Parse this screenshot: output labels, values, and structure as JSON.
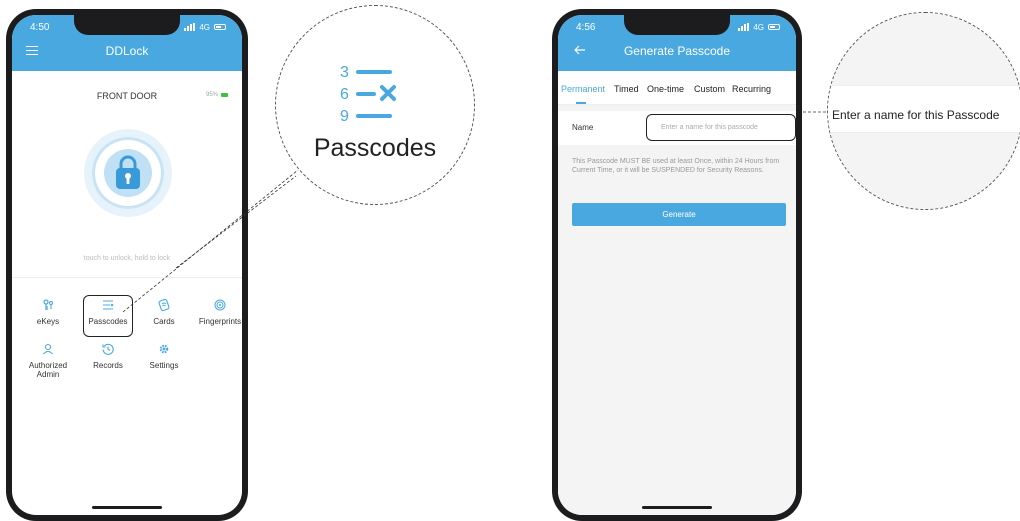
{
  "left_phone": {
    "time": "4:50",
    "network": "4G",
    "app_title": "DDLock",
    "lock_name": "FRONT DOOR",
    "battery": "95%",
    "hint": "touch to unlock, hold to lock",
    "menu": [
      {
        "label": "eKeys",
        "icon": "ekey-icon"
      },
      {
        "label": "Passcodes",
        "icon": "passcode-list-icon"
      },
      {
        "label": "Cards",
        "icon": "card-icon"
      },
      {
        "label": "Fingerprints",
        "icon": "fingerprint-icon"
      },
      {
        "label": "Authorized Admin",
        "icon": "admin-icon"
      },
      {
        "label": "Records",
        "icon": "history-icon"
      },
      {
        "label": "Settings",
        "icon": "gear-icon"
      }
    ]
  },
  "zoom_passcodes": {
    "label": "Passcodes",
    "icon_digits": [
      "3",
      "6",
      "9"
    ]
  },
  "right_phone": {
    "time": "4:56",
    "network": "4G",
    "title": "Generate Passcode",
    "tabs": [
      "Permanent",
      "Timed",
      "One-time",
      "Custom",
      "Recurring"
    ],
    "active_tab": "Permanent",
    "field_label": "Name",
    "field_placeholder": "Enter a name for this passcode",
    "note": "This Passcode MUST BE used at least Once, within 24 Hours from Current Time, or it will be SUSPENDED for Security Reasons.",
    "button": "Generate"
  },
  "zoom_field": {
    "text": "Enter a name for this Passcode"
  },
  "colors": {
    "accent": "#4aa8e0",
    "battery": "#3cc23c"
  }
}
